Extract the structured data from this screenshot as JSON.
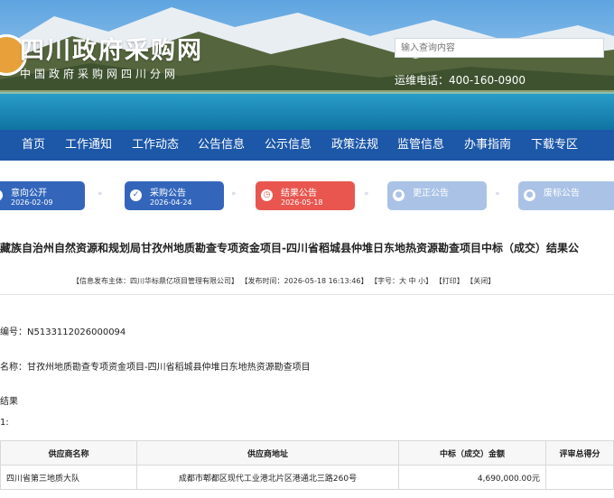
{
  "site": {
    "title": "四川政府采购网",
    "subtitle": "中国政府采购网四川分网",
    "search_placeholder": "输入查询内容",
    "hotline": "运维电话：400-160-0900"
  },
  "nav": {
    "items": [
      "首页",
      "工作通知",
      "工作动态",
      "公告信息",
      "公示信息",
      "政策法规",
      "监管信息",
      "办事指南",
      "下载专区"
    ]
  },
  "steps": [
    {
      "label": "意向公开",
      "date": "2026-02-09",
      "color": "#3366bb"
    },
    {
      "label": "采购公告",
      "date": "2026-04-24",
      "color": "#3366bb"
    },
    {
      "label": "结果公告",
      "date": "2026-05-18",
      "color": "#e8564f"
    },
    {
      "label": "更正公告",
      "date": "",
      "color": "#aac2e6"
    },
    {
      "label": "废标公告",
      "date": "",
      "color": "#aac2e6"
    }
  ],
  "article": {
    "title": "藏族自治州自然资源和规划局甘孜州地质勘查专项资金项目-四川省稻城县仲堆日东地热资源勘查项目中标（成交）结果公",
    "meta": {
      "publisher": "【信息发布主体：四川华标鼎亿项目管理有限公司】",
      "time": "【发布时间：2026-05-18 16:13:46】",
      "font_size": "【字号：大 中 小】",
      "print": "【打印】",
      "close": "【关闭】"
    },
    "fields": {
      "project_no": "编号：N5133112026000094",
      "project_name": "名称：甘孜州地质勘查专项资金项目-四川省稻城县仲堆日东地热资源勘查项目",
      "section": "结果",
      "subsection": "1:"
    }
  },
  "table": {
    "headers": [
      "供应商名称",
      "供应商地址",
      "中标（成交）金额",
      "评审总得分"
    ],
    "rows": [
      [
        "四川省第三地质大队",
        "成都市郫都区现代工业港北片区港通北三路260号",
        "4,690,000.00元",
        ""
      ]
    ]
  }
}
